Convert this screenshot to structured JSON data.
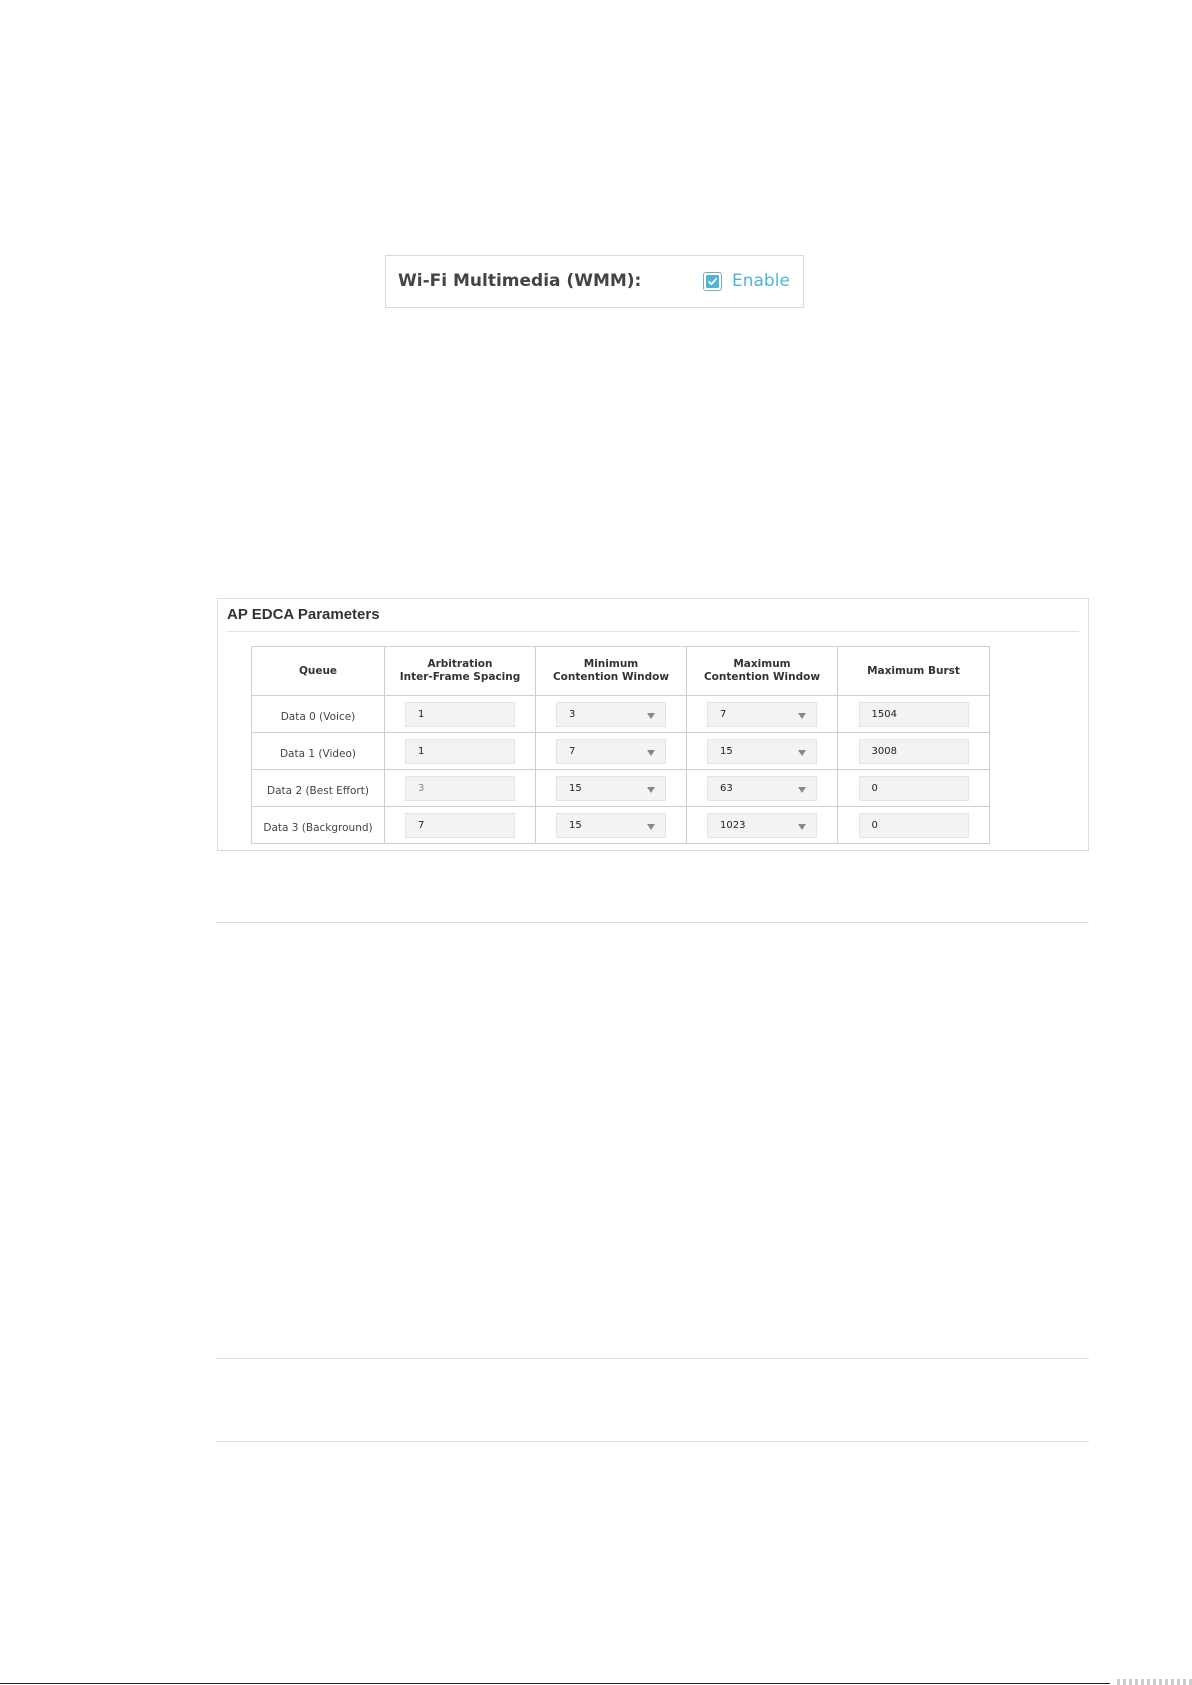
{
  "wmm": {
    "label": "Wi-Fi Multimedia (WMM):",
    "checkbox_checked": true,
    "enable_label": "Enable",
    "accent_color": "#4fb4d8"
  },
  "edca": {
    "title": "AP EDCA Parameters",
    "headers": {
      "queue": "Queue",
      "aifs_line1": "Arbitration",
      "aifs_line2": "Inter-Frame Spacing",
      "cwmin_line1": "Minimum",
      "cwmin_line2": "Contention Window",
      "cwmax_line1": "Maximum",
      "cwmax_line2": "Contention Window",
      "burst": "Maximum Burst"
    },
    "rows": [
      {
        "queue": "Data 0 (Voice)",
        "aifs": "1",
        "cwmin": "3",
        "cwmax": "7",
        "burst": "1504",
        "aifs_disabled": false
      },
      {
        "queue": "Data 1 (Video)",
        "aifs": "1",
        "cwmin": "7",
        "cwmax": "15",
        "burst": "3008",
        "aifs_disabled": false
      },
      {
        "queue": "Data 2 (Best Effort)",
        "aifs": "3",
        "cwmin": "15",
        "cwmax": "63",
        "burst": "0",
        "aifs_disabled": true
      },
      {
        "queue": "Data 3 (Background)",
        "aifs": "7",
        "cwmin": "15",
        "cwmax": "1023",
        "burst": "0",
        "aifs_disabled": false
      }
    ]
  },
  "icons": {
    "checkbox": "check-icon",
    "dropdown": "chevron-down-icon"
  }
}
